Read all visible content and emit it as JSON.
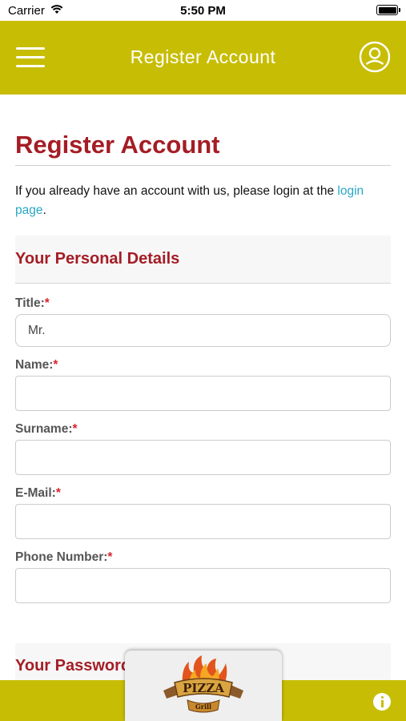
{
  "status_bar": {
    "carrier": "Carrier",
    "time": "5:50 PM"
  },
  "header": {
    "title": "Register Account",
    "menu_icon": "hamburger-icon",
    "account_icon": "user-circle-icon",
    "color": "#c7bd05"
  },
  "page": {
    "title": "Register Account",
    "intro_text": "If you already have an account with us, please login at the ",
    "intro_link": "login page",
    "intro_end": ".",
    "title_color": "#a41d25",
    "link_color": "#2aa6c6"
  },
  "personal_details": {
    "heading": "Your Personal Details",
    "required_mark": "*",
    "fields": [
      {
        "label": "Title:",
        "value": "Mr."
      },
      {
        "label": "Name:",
        "value": ""
      },
      {
        "label": "Surname:",
        "value": ""
      },
      {
        "label": "E-Mail:",
        "value": ""
      },
      {
        "label": "Phone Number:",
        "value": ""
      }
    ]
  },
  "password_section": {
    "heading": "Your Password"
  },
  "footer": {
    "logo_text": "PIZZA",
    "logo_sub": "Grill",
    "info_icon": "info-icon"
  }
}
